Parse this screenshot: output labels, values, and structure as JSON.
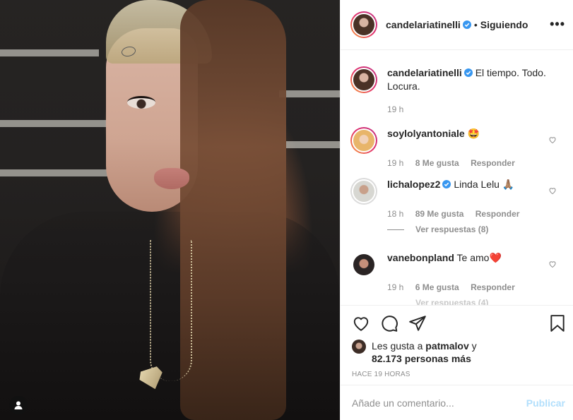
{
  "post": {
    "author": "candelariatinelli",
    "follow_status": "Siguiendo",
    "separator": "•",
    "more_label": "•••",
    "caption": "El tiempo. Todo. Locura.",
    "caption_time": "19 h"
  },
  "comments": [
    {
      "user": "soylolyantoniale",
      "text": "🤩",
      "time": "19 h",
      "likes": "8 Me gusta",
      "reply": "Responder",
      "verified": false
    },
    {
      "user": "lichalopez2",
      "text": "Linda Lelu 🙏🏽",
      "time": "18 h",
      "likes": "89 Me gusta",
      "reply": "Responder",
      "verified": true
    },
    {
      "user": "vanebonpland",
      "text": "Te amo❤️",
      "time": "19 h",
      "likes": "6 Me gusta",
      "reply": "Responder",
      "verified": false
    }
  ],
  "replies_link": "Ver respuestas (8)",
  "replies_link_faded": "Ver respuestas (4)",
  "likes": {
    "prefix": "Les gusta a",
    "user": "patmalov",
    "joiner": "y",
    "count": "82.173 personas más"
  },
  "time_ago": "HACE 19 HORAS",
  "add_comment": {
    "placeholder": "Añade un comentario...",
    "publish": "Publicar"
  },
  "colors": {
    "verified": "#3897f0",
    "link_disabled": "#b2dffc",
    "muted": "#8e8e8e"
  },
  "icons": [
    "heart-icon",
    "comment-icon",
    "share-icon",
    "bookmark-icon",
    "verified-icon",
    "more-icon",
    "user-icon"
  ]
}
